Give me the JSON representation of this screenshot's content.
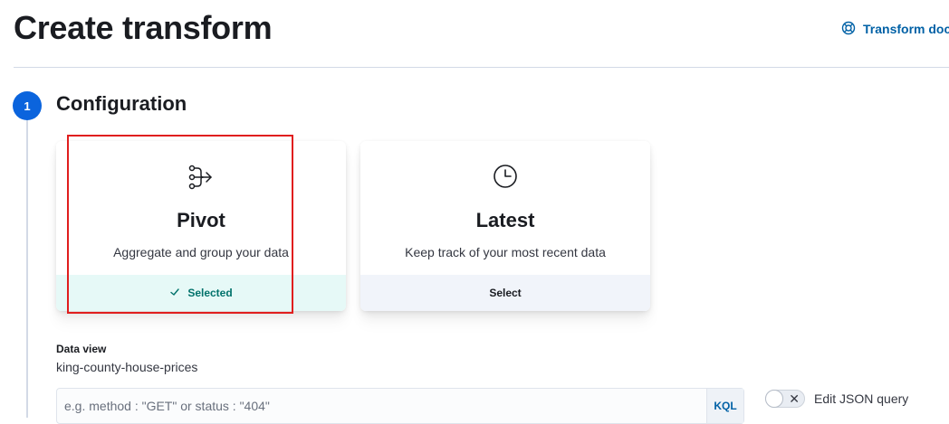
{
  "header": {
    "title": "Create transform",
    "docs_link_label": "Transform docs"
  },
  "step": {
    "number": "1",
    "title": "Configuration"
  },
  "cards": [
    {
      "icon": "pivot-icon",
      "title": "Pivot",
      "description": "Aggregate and group your data",
      "footer_label": "Selected",
      "state": "selected"
    },
    {
      "icon": "clock-icon",
      "title": "Latest",
      "description": "Keep track of your most recent data",
      "footer_label": "Select",
      "state": "unselected"
    }
  ],
  "data_view": {
    "label": "Data view",
    "value": "king-county-house-prices"
  },
  "query": {
    "placeholder": "e.g. method : \"GET\" or status : \"404\"",
    "language_button": "KQL"
  },
  "json_toggle": {
    "label": "Edit JSON query",
    "checked": false
  },
  "colors": {
    "accent": "#0b64dd",
    "link": "#0061a6",
    "selected_bg": "#e6f9f7",
    "selected_text": "#00726b",
    "highlight": "#e01e1e"
  }
}
